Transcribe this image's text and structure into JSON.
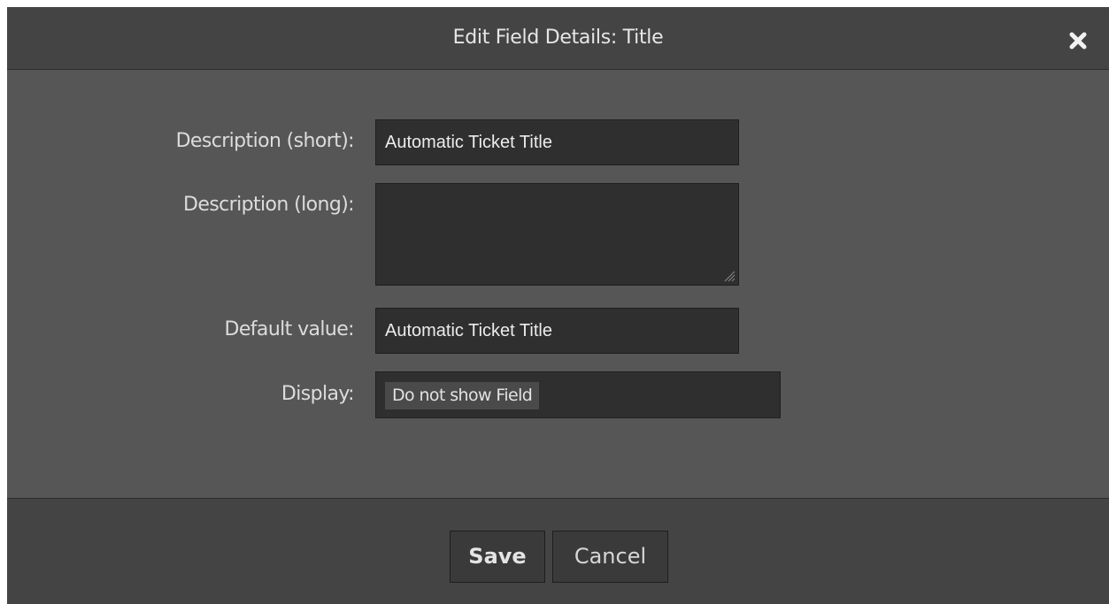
{
  "dialog": {
    "title": "Edit Field Details: Title",
    "close_icon": "close-icon"
  },
  "form": {
    "description_short": {
      "label": "Description (short):",
      "value": "Automatic Ticket Title"
    },
    "description_long": {
      "label": "Description (long):",
      "value": ""
    },
    "default_value": {
      "label": "Default value:",
      "value": "Automatic Ticket Title"
    },
    "display": {
      "label": "Display:",
      "selected": "Do not show Field"
    }
  },
  "footer": {
    "save_label": "Save",
    "cancel_label": "Cancel"
  },
  "colors": {
    "header_bg": "#444444",
    "body_bg": "#565656",
    "input_bg": "#2f2f2f",
    "text": "#e6e6e6"
  }
}
